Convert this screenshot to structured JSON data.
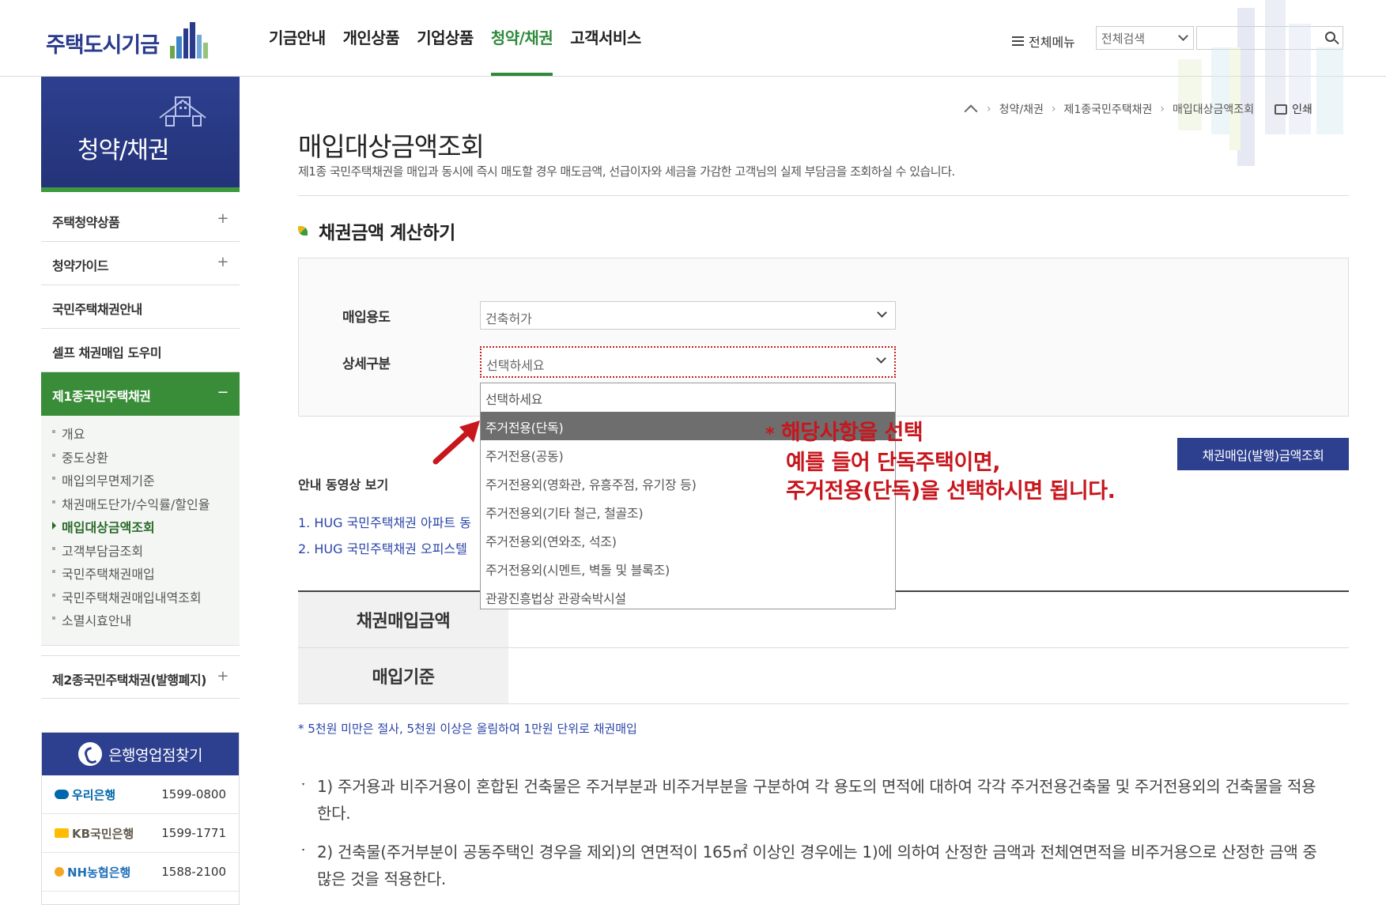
{
  "header": {
    "logo_text": "주택도시기금",
    "nav": [
      {
        "label": "기금안내"
      },
      {
        "label": "개인상품"
      },
      {
        "label": "기업상품"
      },
      {
        "label": "청약/채권"
      },
      {
        "label": "고객서비스"
      }
    ],
    "active_nav": "청약/채권",
    "all_menu": "전체메뉴",
    "search_scope": "전체검색",
    "search_value": ""
  },
  "sidebar": {
    "banner_title": "청약/채권",
    "items": [
      {
        "label": "주택청약상품",
        "toggle": "+"
      },
      {
        "label": "청약가이드",
        "toggle": "+"
      },
      {
        "label": "국민주택채권안내",
        "toggle": ""
      },
      {
        "label": "셀프 채권매입 도우미",
        "toggle": ""
      },
      {
        "label": "제1종국민주택채권",
        "toggle": "−"
      }
    ],
    "sub_items": [
      {
        "label": "개요"
      },
      {
        "label": "중도상환"
      },
      {
        "label": "매입의무면제기준"
      },
      {
        "label": "채권매도단가/수익률/할인율"
      },
      {
        "label": "매입대상금액조회"
      },
      {
        "label": "고객부담금조회"
      },
      {
        "label": "국민주택채권매입"
      },
      {
        "label": "국민주택채권매입내역조회"
      },
      {
        "label": "소멸시효안내"
      }
    ],
    "active_sub": "매입대상금액조회",
    "last_item": {
      "label": "제2종국민주택채권(발행폐지)",
      "toggle": "+"
    },
    "bank_finder": {
      "title": "은행영업점찾기",
      "banks": [
        {
          "name": "우리은행",
          "tel": "1599-0800",
          "color": "#0067ac"
        },
        {
          "name": "KB국민은행",
          "tel": "1599-1771",
          "color": "#ffbc00"
        },
        {
          "name": "NH농협은행",
          "tel": "1588-2100",
          "color": "#1f6fb8"
        }
      ]
    }
  },
  "breadcrumb": {
    "items": [
      "청약/채권",
      "제1종국민주택채권",
      "매입대상금액조회"
    ],
    "print": "인쇄"
  },
  "page": {
    "title": "매입대상금액조회",
    "description": "제1종 국민주택채권을 매입과 동시에 즉시 매도할 경우 매도금액, 선급이자와 세금을 가감한 고객님의 실제 부담금을 조회하실 수 있습니다.",
    "section_title": "채권금액 계산하기"
  },
  "form": {
    "purpose_label": "매입용도",
    "purpose_value": "건축허가",
    "detail_label": "상세구분",
    "detail_value": "선택하세요",
    "detail_options": [
      "선택하세요",
      "주거전용(단독)",
      "주거전용(공동)",
      "주거전용외(영화관, 유흥주점, 유기장 등)",
      "주거전용외(기타 철근, 철골조)",
      "주거전용외(연와조, 석조)",
      "주거전용외(시멘트, 벽돌 및 블록조)",
      "관광진흥법상 관광숙박시설"
    ],
    "highlighted_option": "주거전용(단독)"
  },
  "videos": {
    "title": "안내 동영상 보기",
    "links": [
      "1. HUG 국민주택채권 아파트 동",
      "2. HUG 국민주택채권 오피스텔"
    ]
  },
  "lookup_button": "채권매입(발행)금액조회",
  "result": {
    "rows": [
      {
        "label": "채권매입금액",
        "value": ""
      },
      {
        "label": "매입기준",
        "value": ""
      }
    ]
  },
  "note": "* 5천원 미만은 절사, 5천원 이상은 올림하여 1만원 단위로 채권매입",
  "paragraphs": [
    "1) 주거용과 비주거용이 혼합된 건축물은 주거부분과 비주거부분을 구분하여 각 용도의 면적에 대하여 각각 주거전용건축물 및 주거전용외의 건축물을 적용한다.",
    "2) 건축물(주거부분이 공동주택인 경우을 제외)의 연면적이 165㎡ 이상인 경우에는 1)에 의하여 산정한 금액과 전체연면적을 비주거용으로 산정한 금액 중 많은 것을 적용한다."
  ],
  "annotation": {
    "mark": "*",
    "line1": "해당사항을 선택",
    "line2": "예를 들어 단독주택이면,",
    "line3": "주거전용(단독)을 선택하시면 됩니다."
  },
  "colors": {
    "brand_navy": "#2d3f8f",
    "brand_green": "#3a8d38",
    "annotation_red": "#c8161d"
  }
}
